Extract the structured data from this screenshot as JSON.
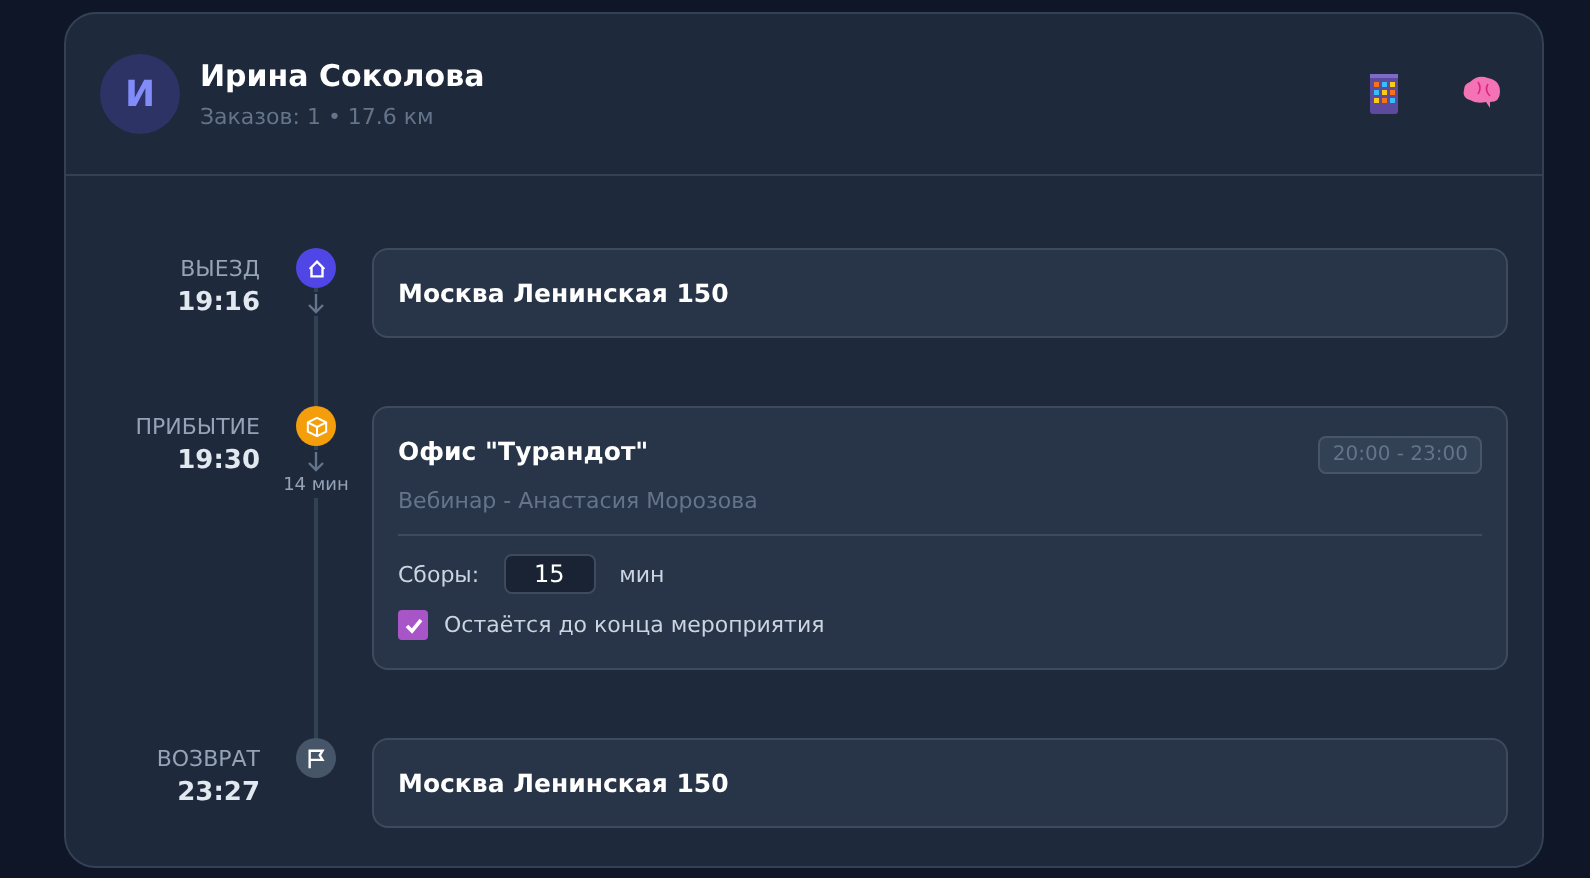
{
  "driver": {
    "initial": "И",
    "name": "Ирина Соколова",
    "meta": "Заказов: 1 • 17.6 км"
  },
  "stops": [
    {
      "kind": "depart",
      "label": "ВЫЕЗД",
      "time": "19:16",
      "color": "#4f46e5",
      "address": "Москва Ленинская 150"
    },
    {
      "kind": "arrive",
      "label": "ПРИБЫТИЕ",
      "time": "19:30",
      "color": "#f59e0b",
      "address": "Офис \"Турандот\"",
      "travel": "14 мин",
      "window": "20:00 - 23:00",
      "subtitle": "Вебинар - Анастасия Морозова",
      "setup_label": "Сборы:",
      "setup_value": "15",
      "setup_unit": "мин",
      "stay_label": "Остаётся до конца мероприятия",
      "stay_checked": true
    },
    {
      "kind": "return",
      "label": "ВОЗВРАТ",
      "time": "23:27",
      "color": "#475569",
      "address": "Москва Ленинская 150"
    }
  ]
}
